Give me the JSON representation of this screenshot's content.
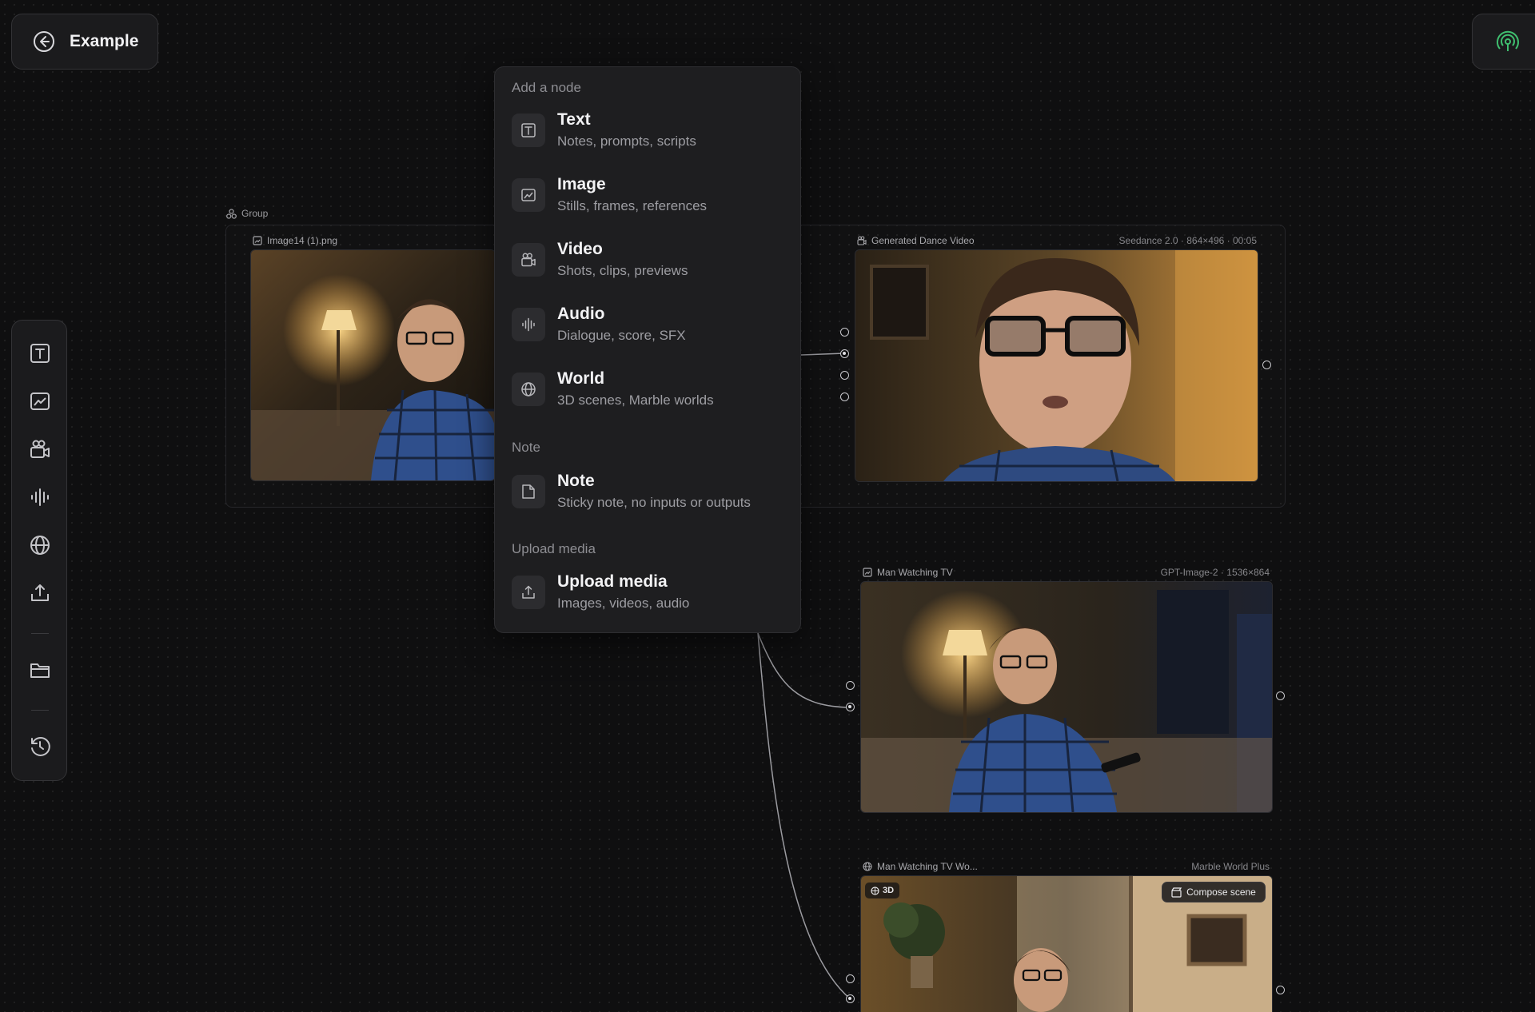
{
  "header": {
    "title": "Example",
    "back_icon": "back-arrow-icon",
    "broadcast_icon": "broadcast-icon",
    "broadcast_color": "#3fbf6f"
  },
  "toolbar": {
    "tools": [
      "text-icon",
      "image-icon",
      "video-icon",
      "audio-icon",
      "world-icon",
      "upload-icon",
      "folder-icon",
      "history-icon"
    ]
  },
  "canvas": {
    "group_label": "Group",
    "nodes": {
      "source_image": {
        "label": "Image14 (1).png"
      },
      "dance_video": {
        "label": "Generated Dance Video",
        "meta": "Seedance 2.0 · 864×496 · 00:05"
      },
      "man_tv": {
        "label": "Man Watching TV",
        "meta": "GPT-Image-2 · 1536×864"
      },
      "man_tv_world": {
        "label": "Man Watching TV Wo...",
        "meta": "Marble World Plus",
        "badge": "3D",
        "action": "Compose scene"
      }
    }
  },
  "menu": {
    "add_node_header": "Add a node",
    "items": [
      {
        "title": "Text",
        "subtitle": "Notes, prompts, scripts",
        "icon": "text-icon"
      },
      {
        "title": "Image",
        "subtitle": "Stills, frames, references",
        "icon": "image-icon"
      },
      {
        "title": "Video",
        "subtitle": "Shots, clips, previews",
        "icon": "video-icon"
      },
      {
        "title": "Audio",
        "subtitle": "Dialogue, score, SFX",
        "icon": "audio-icon"
      },
      {
        "title": "World",
        "subtitle": "3D scenes, Marble worlds",
        "icon": "globe-icon"
      }
    ],
    "note_header": "Note",
    "note_item": {
      "title": "Note",
      "subtitle": "Sticky note, no inputs or outputs",
      "icon": "note-icon"
    },
    "upload_header": "Upload media",
    "upload_item": {
      "title": "Upload media",
      "subtitle": "Images, videos, audio",
      "icon": "upload-icon"
    }
  }
}
